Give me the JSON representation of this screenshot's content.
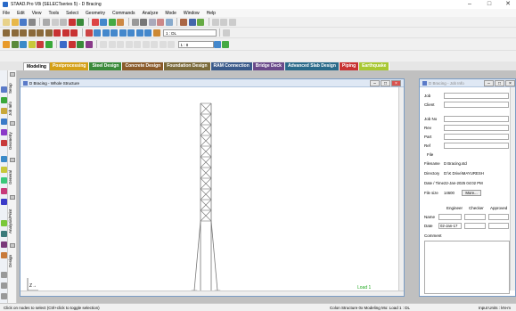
{
  "app": {
    "title": "STAAD.Pro V8i (SELECTseries 5) - D Bracing",
    "min_glyph": "–",
    "max_glyph": "□",
    "close_glyph": "✕"
  },
  "menu": [
    "File",
    "Edit",
    "View",
    "Tools",
    "Select",
    "Geometry",
    "Commands",
    "Analyze",
    "Mode",
    "Window",
    "Help"
  ],
  "toolbar": {
    "load_combo": "1 : DL",
    "unit_label": "1 : 8"
  },
  "ribbon_tabs": [
    {
      "label": "Modeling",
      "color": "#ffffff"
    },
    {
      "label": "Postprocessing",
      "color": "#d4a017"
    },
    {
      "label": "Steel Design",
      "color": "#3a8a3a"
    },
    {
      "label": "Concrete Design",
      "color": "#8a5a2a"
    },
    {
      "label": "Foundation Design",
      "color": "#7a6a3a"
    },
    {
      "label": "RAM Connection",
      "color": "#3a5a8a"
    },
    {
      "label": "Bridge Deck",
      "color": "#6a4a8a"
    },
    {
      "label": "Advanced Slab Design",
      "color": "#2a6a8a"
    },
    {
      "label": "Piping",
      "color": "#c83232"
    },
    {
      "label": "Earthquake",
      "color": "#a8c832"
    }
  ],
  "page_tabs": [
    "Setup",
    "Job Info",
    "Geometry",
    "General",
    "Analysis/Print",
    "Design"
  ],
  "structure_window": {
    "title": "D Bracing - Whole Structure",
    "load_label": "Load 1"
  },
  "job_info_window": {
    "title": "D Bracing - Job Info",
    "fields": [
      "Job",
      "Client",
      "Job No",
      "Rev",
      "Part",
      "Ref"
    ],
    "file_section": "File",
    "file_info": [
      {
        "key": "Filename",
        "value": "D Bracing.std"
      },
      {
        "key": "Directory",
        "value": "D:\\K Drive\\MAYURESH"
      },
      {
        "key": "Date / Time",
        "value": "22-Jan-2025   04:02 PM"
      },
      {
        "key": "File size",
        "value": "14600"
      }
    ],
    "more_button": "More...",
    "col_headers": [
      "Engineer",
      "Checker",
      "Approved"
    ],
    "row_labels": [
      "Name",
      "Date"
    ],
    "date_value": "02-Jan-17",
    "comment_label": "Comment"
  },
  "status": {
    "left": "Click on nodes to select (Ctrl+click to toggle selection)",
    "middle": "Colon Structure 0x Modeling Mo: Load 1 : DL",
    "right": "Input Units : kN-m"
  },
  "colors": {
    "mdi_background": "#c0c0c0",
    "structure_line": "#777777",
    "load_label": "#22aa22"
  }
}
